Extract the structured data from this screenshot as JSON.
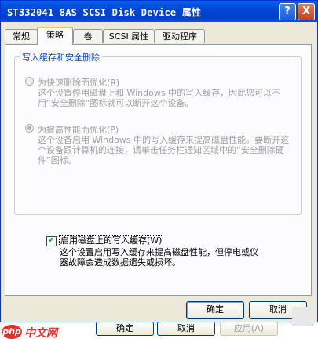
{
  "window": {
    "title": "ST332041 8AS SCSI Disk Device 属性",
    "help_label": "?",
    "close_label": "X"
  },
  "tabs": [
    {
      "label": "常规",
      "active": false
    },
    {
      "label": "策略",
      "active": true
    },
    {
      "label": "卷",
      "active": false
    },
    {
      "label": "SCSI 属性",
      "active": false
    },
    {
      "label": "驱动程序",
      "active": false
    }
  ],
  "group": {
    "title": "写入缓存和安全删除",
    "options": [
      {
        "label": "为快速删除而优化(R)",
        "description": "这个设置停用磁盘上和 Windows 中的写入缓存，因此您可以不用“安全删除”图标就可以断开这个设备。",
        "selected": false,
        "enabled": false
      },
      {
        "label": "为提高性能而优化(P)",
        "description": "这个设备启用 Windows 中的写入缓存来提高磁盘性能。要断开这个设备跟计算机的连接，请单击任务栏通知区域中的“安全删除硬件”图标。",
        "selected": true,
        "enabled": false
      }
    ]
  },
  "write_cache": {
    "label": "启用磁盘上的写入缓存(W)",
    "checked": true,
    "description": "这个设置启用写入缓存来提高磁盘性能，但停电或仪器故障会造成数据遗失或损坏。"
  },
  "dialog_buttons": {
    "ok": "确定",
    "cancel": "取消"
  },
  "background_buttons": {
    "ok": "确定",
    "cancel": "取消",
    "apply": "应用(A)"
  },
  "watermark": {
    "logo": "php",
    "text": "中文网"
  },
  "colors": {
    "titlebar": "#0054e3",
    "group_title": "#0046d5",
    "watermark": "#e4312d"
  }
}
